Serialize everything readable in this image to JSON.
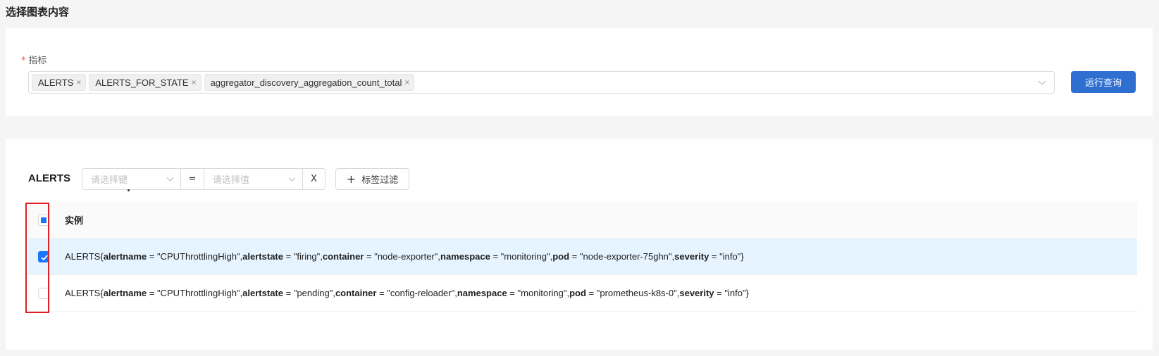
{
  "page_title": "选择图表内容",
  "metrics_section": {
    "required_mark": "*",
    "label": "指标",
    "selected_tags": [
      {
        "label": "ALERTS",
        "remove_glyph": "×"
      },
      {
        "label": "ALERTS_FOR_STATE",
        "remove_glyph": "×"
      },
      {
        "label": "aggregator_discovery_aggregation_count_total",
        "remove_glyph": "×"
      }
    ],
    "run_button_label": "运行查询"
  },
  "results_section": {
    "title": "ALERTS",
    "filter": {
      "key_placeholder": "请选择键",
      "operator": "=",
      "value_placeholder": "请选择值",
      "clear_label": "X"
    },
    "tag_filter_button": {
      "icon": "plus-icon",
      "label": "标签过滤"
    },
    "table": {
      "column_header": "实例",
      "header_checkbox_state": "indeterminate",
      "rows": [
        {
          "checked": true,
          "prefix": "ALERTS{",
          "pairs": [
            {
              "key": "alertname",
              "eq": " = ",
              "value": "\"CPUThrottlingHigh\"",
              "sep": ","
            },
            {
              "key": "alertstate",
              "eq": " = ",
              "value": "\"firing\"",
              "sep": ","
            },
            {
              "key": "container",
              "eq": " = ",
              "value": "\"node-exporter\"",
              "sep": ","
            },
            {
              "key": "namespace",
              "eq": " = ",
              "value": "\"monitoring\"",
              "sep": ","
            },
            {
              "key": "pod",
              "eq": " = ",
              "value": "\"node-exporter-75ghn\"",
              "sep": ","
            },
            {
              "key": "severity",
              "eq": " = ",
              "value": "\"info\"",
              "sep": ""
            }
          ],
          "suffix": "}"
        },
        {
          "checked": false,
          "prefix": "ALERTS{",
          "pairs": [
            {
              "key": "alertname",
              "eq": " = ",
              "value": "\"CPUThrottlingHigh\"",
              "sep": ","
            },
            {
              "key": "alertstate",
              "eq": " = ",
              "value": "\"pending\"",
              "sep": ","
            },
            {
              "key": "container",
              "eq": " = ",
              "value": "\"config-reloader\"",
              "sep": ","
            },
            {
              "key": "namespace",
              "eq": " = ",
              "value": "\"monitoring\"",
              "sep": ","
            },
            {
              "key": "pod",
              "eq": " = ",
              "value": "\"prometheus-k8s-0\"",
              "sep": ","
            },
            {
              "key": "severity",
              "eq": " = ",
              "value": "\"info\"",
              "sep": ""
            }
          ],
          "suffix": "}"
        }
      ]
    }
  },
  "colors": {
    "primary": "#2f6fd1",
    "checkbox_blue": "#1677ff",
    "selected_row_bg": "#e6f4ff",
    "required_red": "#ff4d4f",
    "annotation_red": "#e02020"
  }
}
